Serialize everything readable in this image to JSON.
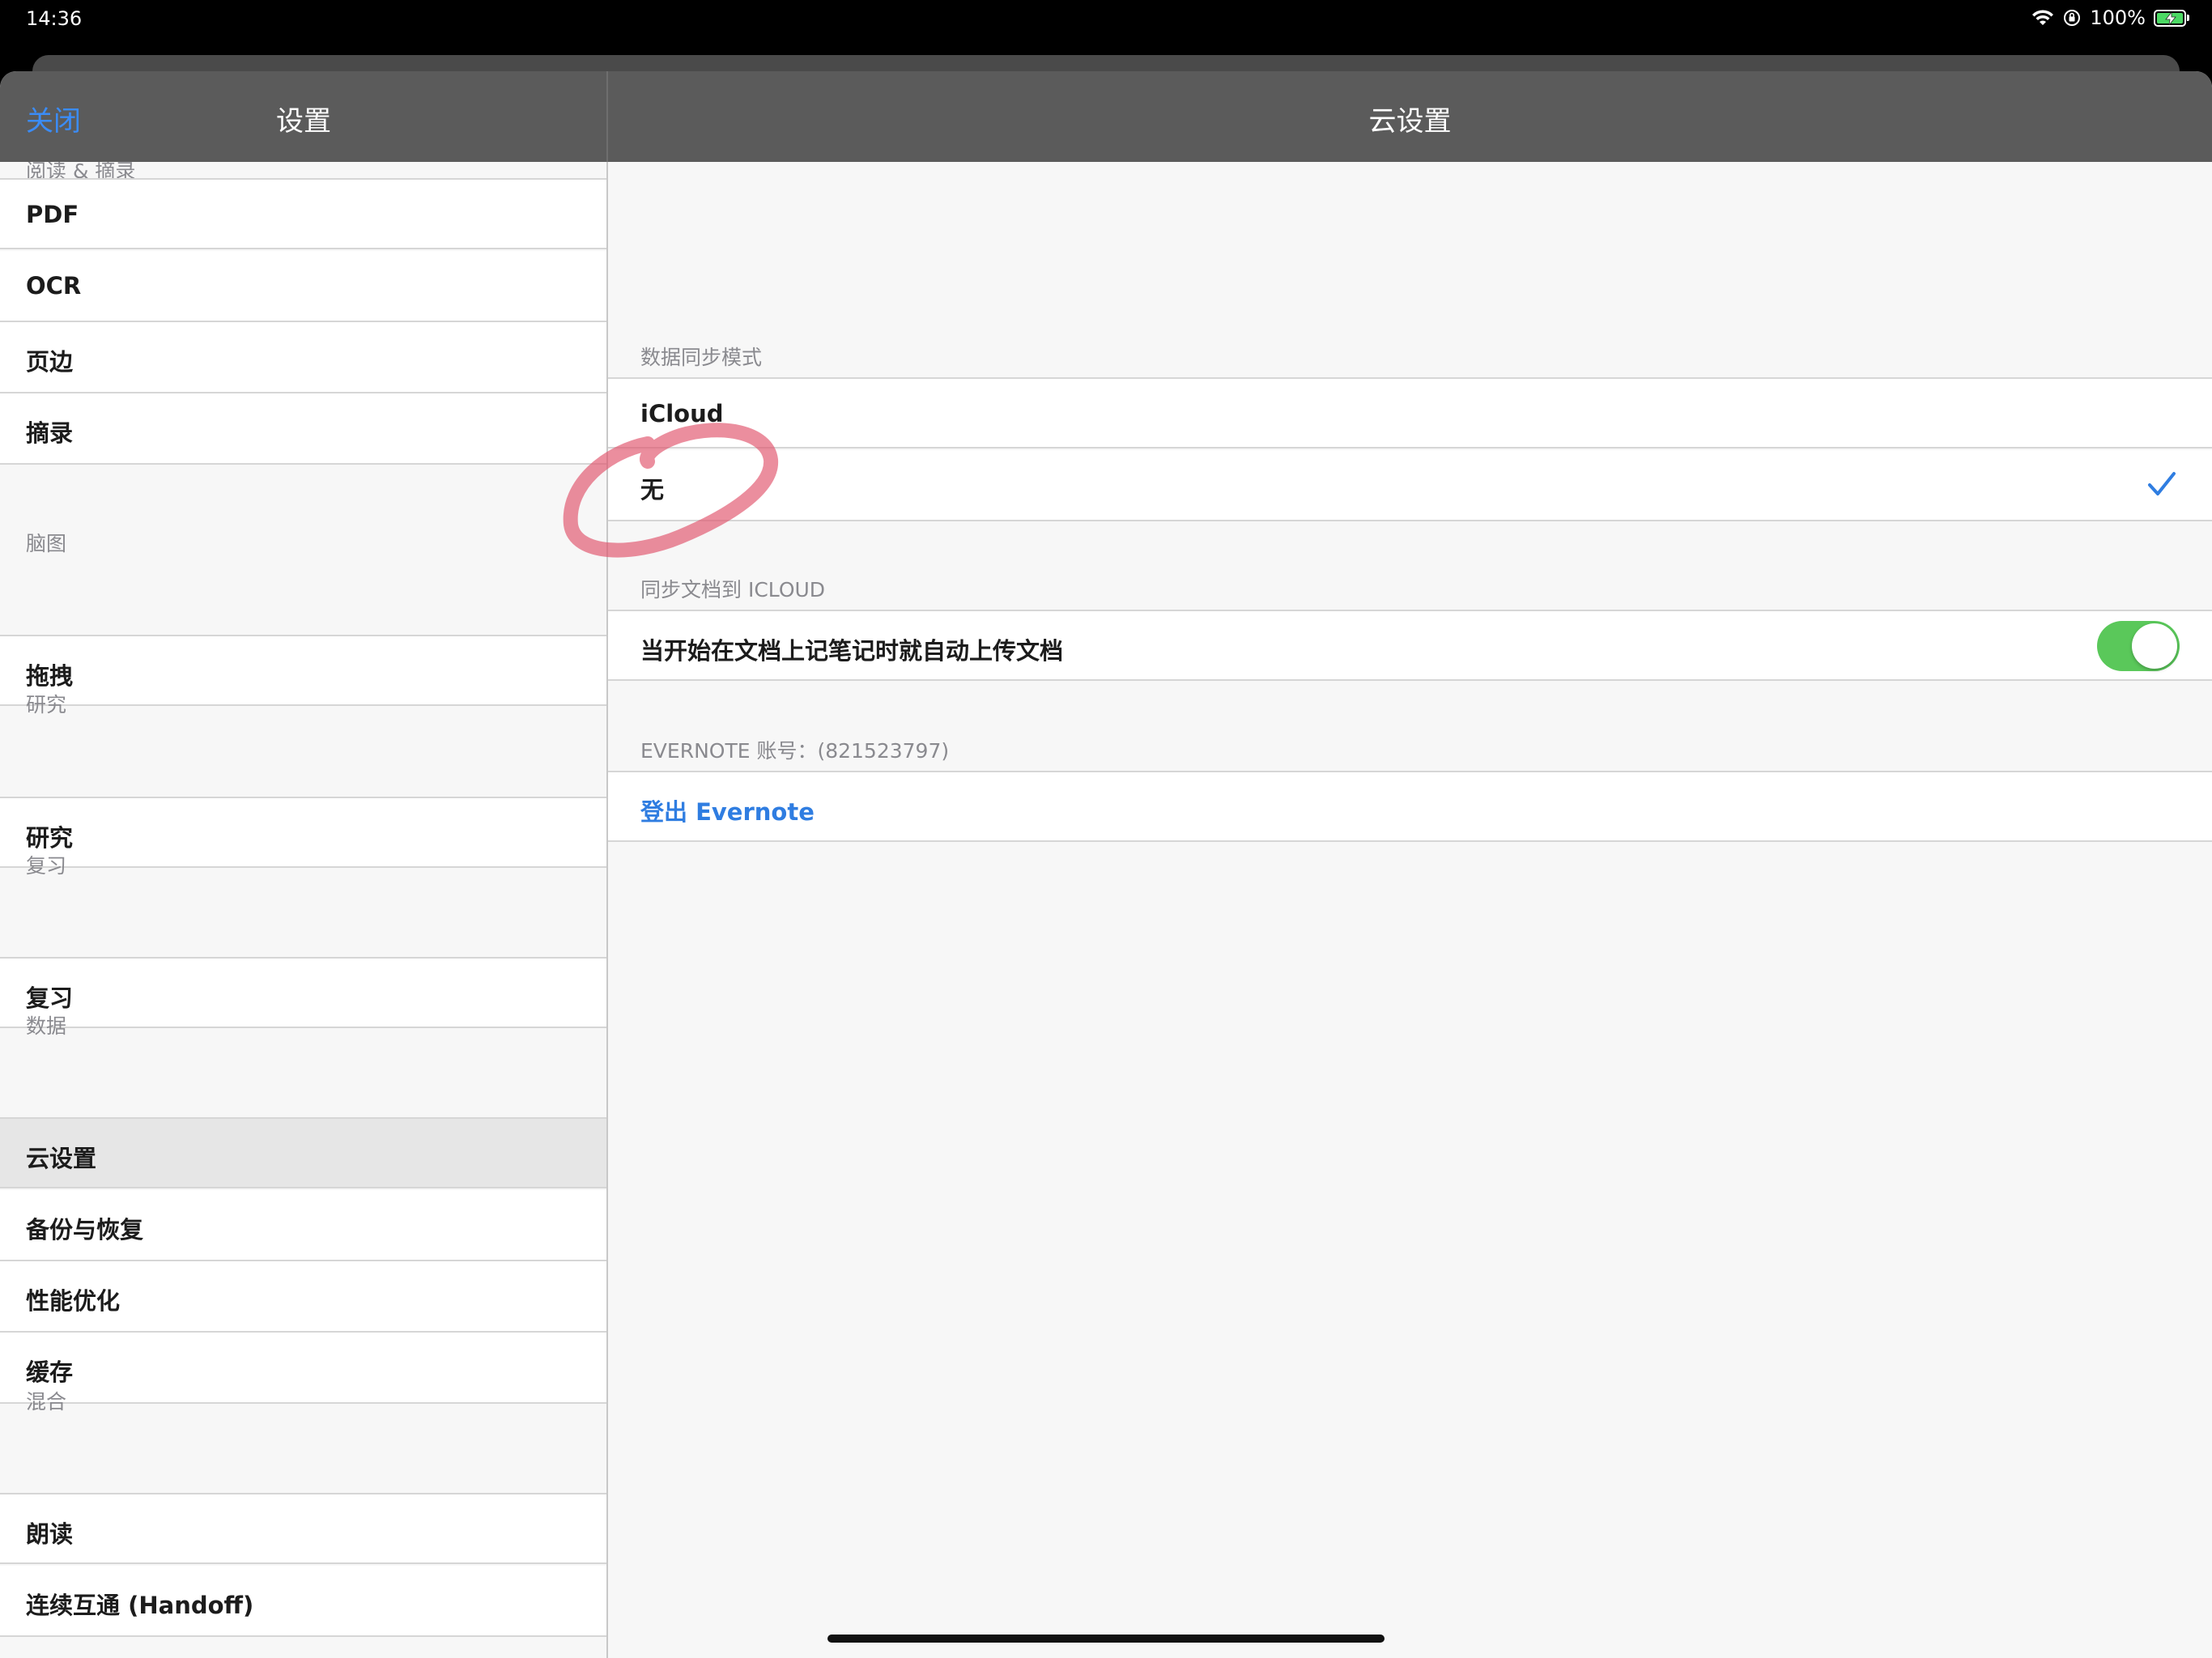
{
  "status_bar": {
    "time": "14:36",
    "battery_text": "100%",
    "icons": [
      "wifi-icon",
      "orientation-lock-icon",
      "battery-charging-icon"
    ]
  },
  "nav": {
    "close_label": "关闭",
    "settings_title": "设置",
    "detail_title": "云设置"
  },
  "sidebar": {
    "top_partial_header": "阅读 & 摘录",
    "group1": [
      "PDF",
      "OCR",
      "页边",
      "摘录"
    ],
    "header2": "脑图",
    "group2": [
      "拖拽"
    ],
    "header3": "研究",
    "group3": [
      "研究"
    ],
    "header4": "复习",
    "group4": [
      "复习"
    ],
    "header5": "数据",
    "group5": [
      "云设置",
      "备份与恢复",
      "性能优化",
      "缓存"
    ],
    "header6": "混合",
    "group6": [
      "朗读",
      "连续互通 (Handoff)"
    ],
    "selected": "云设置"
  },
  "detail": {
    "sync_mode_header": "数据同步模式",
    "sync_options": [
      "iCloud",
      "无"
    ],
    "selected_option": "无",
    "icloud_header": "同步文档到 ICLOUD",
    "auto_upload_label": "当开始在文档上记笔记时就自动上传文档",
    "auto_upload_on": true,
    "evernote_header": "EVERNOTE 账号：(821523797)",
    "evernote_logout": "登出 Evernote"
  },
  "colors": {
    "accent": "#2f7de1",
    "toggle_on": "#5ac85a",
    "nav_bar": "#5b5b5b",
    "annotation": "#e0526a"
  }
}
